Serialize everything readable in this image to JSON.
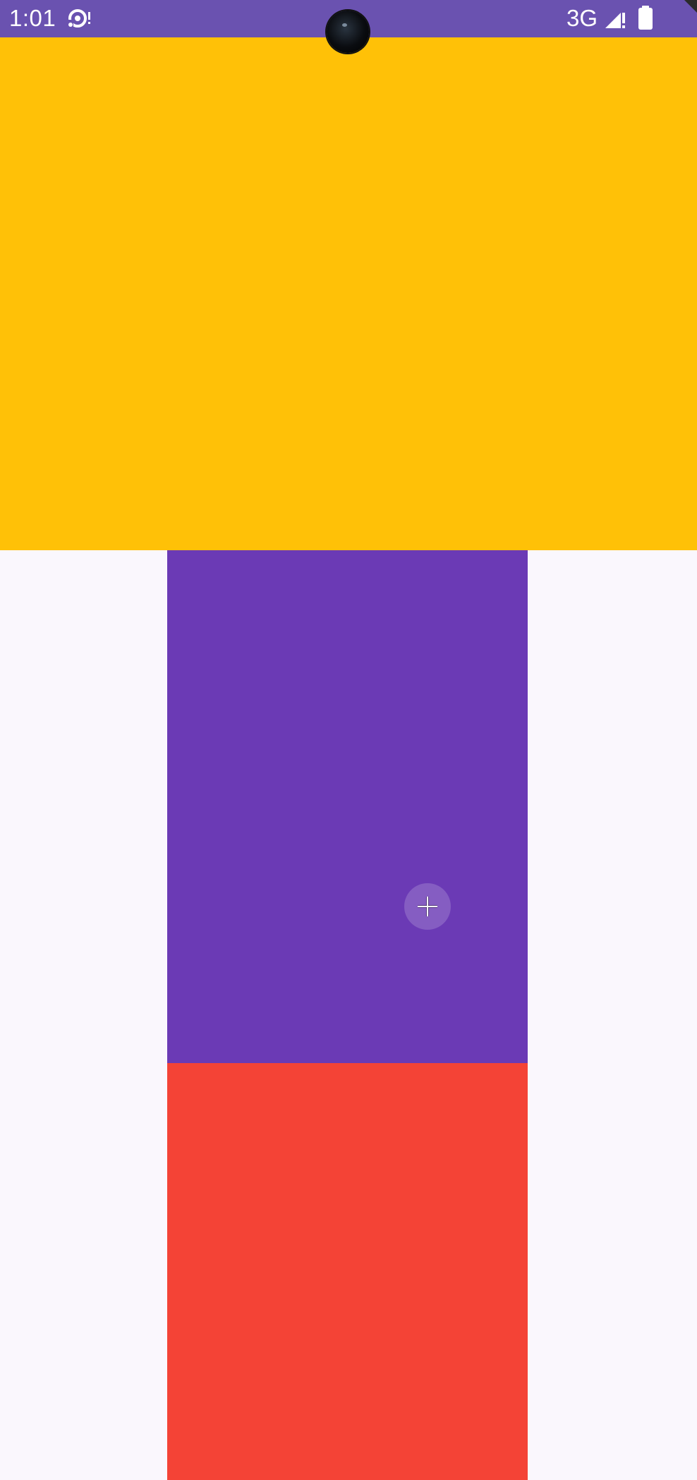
{
  "status_bar": {
    "time": "1:01",
    "network": "3G",
    "color": "#6A52B0"
  },
  "icons": {
    "sync": "sync-icon",
    "signal": "cellular-signal-alert-icon",
    "battery": "battery-full-icon",
    "touch": "crosshair-icon"
  },
  "panels": {
    "top_color": "#FFC107",
    "middle_color": "#6B3AB5",
    "bottom_color": "#F44336",
    "background_color": "#FAF7FD"
  }
}
